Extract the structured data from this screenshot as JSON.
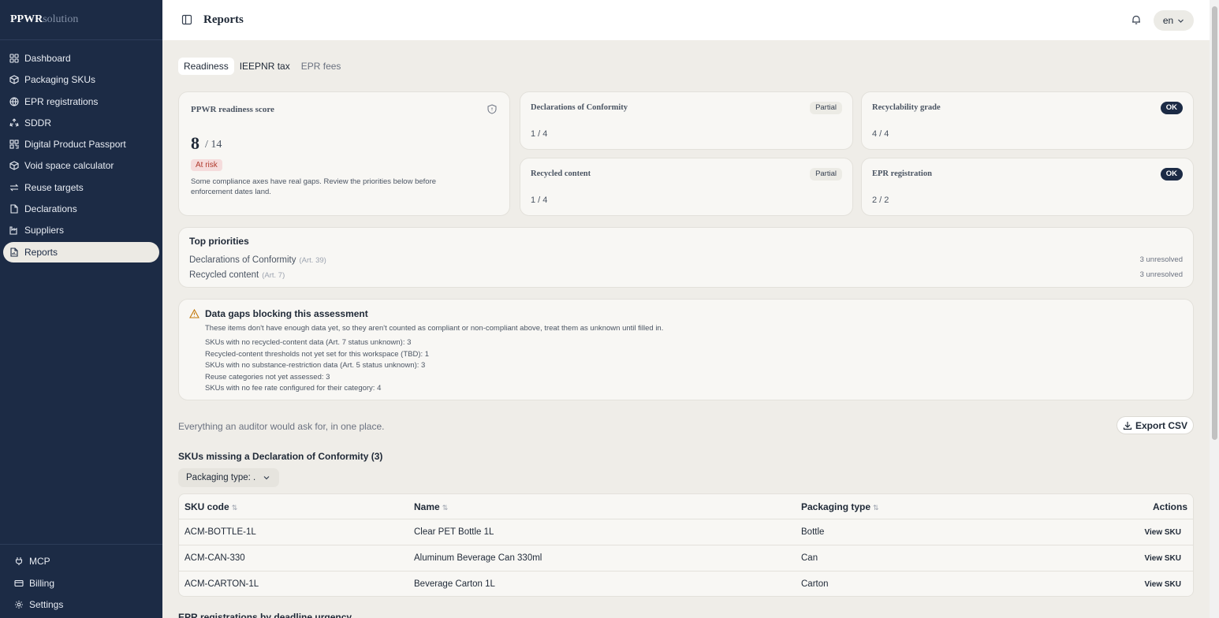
{
  "brand": {
    "strong": "PPWR",
    "light": "solution"
  },
  "sidebar": {
    "items": [
      {
        "label": "Dashboard",
        "icon": "grid-icon"
      },
      {
        "label": "Packaging SKUs",
        "icon": "box-icon"
      },
      {
        "label": "EPR registrations",
        "icon": "globe-icon"
      },
      {
        "label": "SDDR",
        "icon": "recycle-icon"
      },
      {
        "label": "Digital Product Passport",
        "icon": "qr-icon"
      },
      {
        "label": "Void space calculator",
        "icon": "cube-icon"
      },
      {
        "label": "Reuse targets",
        "icon": "repeat-icon"
      },
      {
        "label": "Declarations",
        "icon": "file-icon"
      },
      {
        "label": "Suppliers",
        "icon": "factory-icon"
      },
      {
        "label": "Reports",
        "icon": "report-icon",
        "active": true
      }
    ],
    "bottom": [
      {
        "label": "MCP",
        "icon": "plug-icon"
      },
      {
        "label": "Billing",
        "icon": "card-icon"
      },
      {
        "label": "Settings",
        "icon": "gear-icon"
      }
    ]
  },
  "header": {
    "title": "Reports",
    "lang": "en"
  },
  "tabs": [
    "Readiness",
    "IEEPNR tax",
    "EPR fees"
  ],
  "score_card": {
    "title": "PPWR readiness score",
    "score": "8",
    "total": "/ 14",
    "status": "At risk",
    "description": "Some compliance axes have real gaps. Review the priorities below before enforcement dates land."
  },
  "metrics": [
    {
      "title": "Declarations of Conformity",
      "value": "1 / 4",
      "badge": "Partial"
    },
    {
      "title": "Recyclability grade",
      "value": "4 / 4",
      "badge": "OK"
    },
    {
      "title": "Recycled content",
      "value": "1 / 4",
      "badge": "Partial"
    },
    {
      "title": "EPR registration",
      "value": "2 / 2",
      "badge": "OK"
    }
  ],
  "priorities": {
    "title": "Top priorities",
    "items": [
      {
        "name": "Declarations of Conformity",
        "article": "(Art. 39)",
        "count": "3 unresolved"
      },
      {
        "name": "Recycled content",
        "article": "(Art. 7)",
        "count": "3 unresolved"
      }
    ]
  },
  "gaps": {
    "title": "Data gaps blocking this assessment",
    "intro": "These items don't have enough data yet, so they aren't counted as compliant or non-compliant above, treat them as unknown until filled in.",
    "lines": [
      "SKUs with no recycled-content data (Art. 7 status unknown): 3",
      "Recycled-content thresholds not yet set for this workspace (TBD): 1",
      "SKUs with no substance-restriction data (Art. 5 status unknown): 3",
      "Reuse categories not yet assessed: 3",
      "SKUs with no fee rate configured for their category: 4"
    ]
  },
  "audit": {
    "note": "Everything an auditor would ask for, in one place.",
    "export_label": "Export CSV"
  },
  "missing_doc": {
    "title": "SKUs missing a Declaration of Conformity (3)",
    "filter_label": "Packaging type: .",
    "columns": [
      "SKU code",
      "Name",
      "Packaging type",
      "Actions"
    ],
    "rows": [
      {
        "sku": "ACM-BOTTLE-1L",
        "name": "Clear PET Bottle 1L",
        "type": "Bottle",
        "action": "View SKU"
      },
      {
        "sku": "ACM-CAN-330",
        "name": "Aluminum Beverage Can 330ml",
        "type": "Can",
        "action": "View SKU"
      },
      {
        "sku": "ACM-CARTON-1L",
        "name": "Beverage Carton 1L",
        "type": "Carton",
        "action": "View SKU"
      }
    ]
  },
  "next_section": {
    "title": "EPR registrations by deadline urgency"
  }
}
